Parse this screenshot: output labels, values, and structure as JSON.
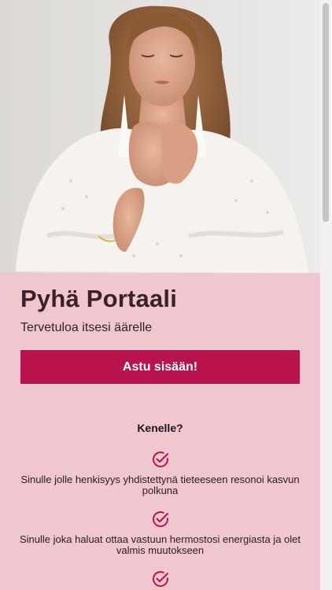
{
  "hero": {
    "image_alt": "Woman with eyes closed, hands on her chest, wearing a white lace dress and feather earrings"
  },
  "portal": {
    "title": "Pyhä Portaali",
    "subtitle": "Tervetuloa itsesi äärelle",
    "cta_label": "Astu sisään!"
  },
  "audience": {
    "heading": "Kenelle?",
    "items": [
      {
        "icon": "check-circle-icon",
        "text": "Sinulle jolle henkisyys yhdistettynä tieteeseen resonoi kasvun polkuna"
      },
      {
        "icon": "check-circle-icon",
        "text": "Sinulle joka haluat ottaa vastuun hermostosi energiasta ja olet valmis muutokseen"
      },
      {
        "icon": "check-circle-icon",
        "text": ""
      }
    ]
  },
  "colors": {
    "background": "#f0c6cf",
    "accent": "#b9134e",
    "title": "#3a2228"
  }
}
